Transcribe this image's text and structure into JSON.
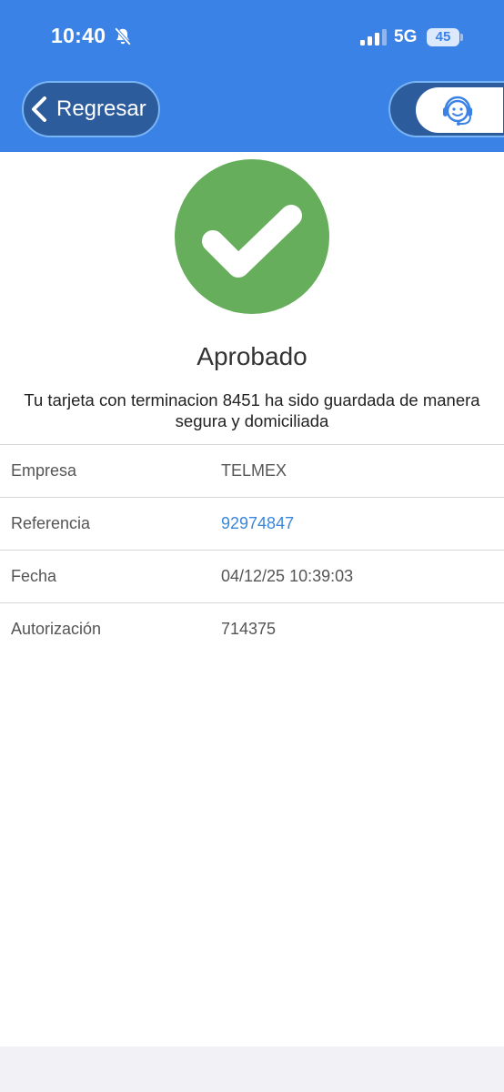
{
  "status_bar": {
    "time": "10:40",
    "network": "5G",
    "battery": "45"
  },
  "header": {
    "back_label": "Regresar"
  },
  "result": {
    "title": "Aprobado",
    "message": "Tu tarjeta con terminacion 8451 ha sido guardada de manera segura y domiciliada"
  },
  "details": [
    {
      "label": "Empresa",
      "value": "TELMEX"
    },
    {
      "label": "Referencia",
      "value": "92974847"
    },
    {
      "label": "Fecha",
      "value": "04/12/25 10:39:03"
    },
    {
      "label": "Autorización",
      "value": "714375"
    }
  ],
  "colors": {
    "header_bg": "#3a82e6",
    "success_green": "#66ae5c",
    "link_blue": "#3a86d9"
  },
  "icons": [
    "bell-off-icon",
    "signal-icon",
    "battery-icon",
    "chevron-left-icon",
    "headset-icon",
    "checkmark-icon"
  ]
}
